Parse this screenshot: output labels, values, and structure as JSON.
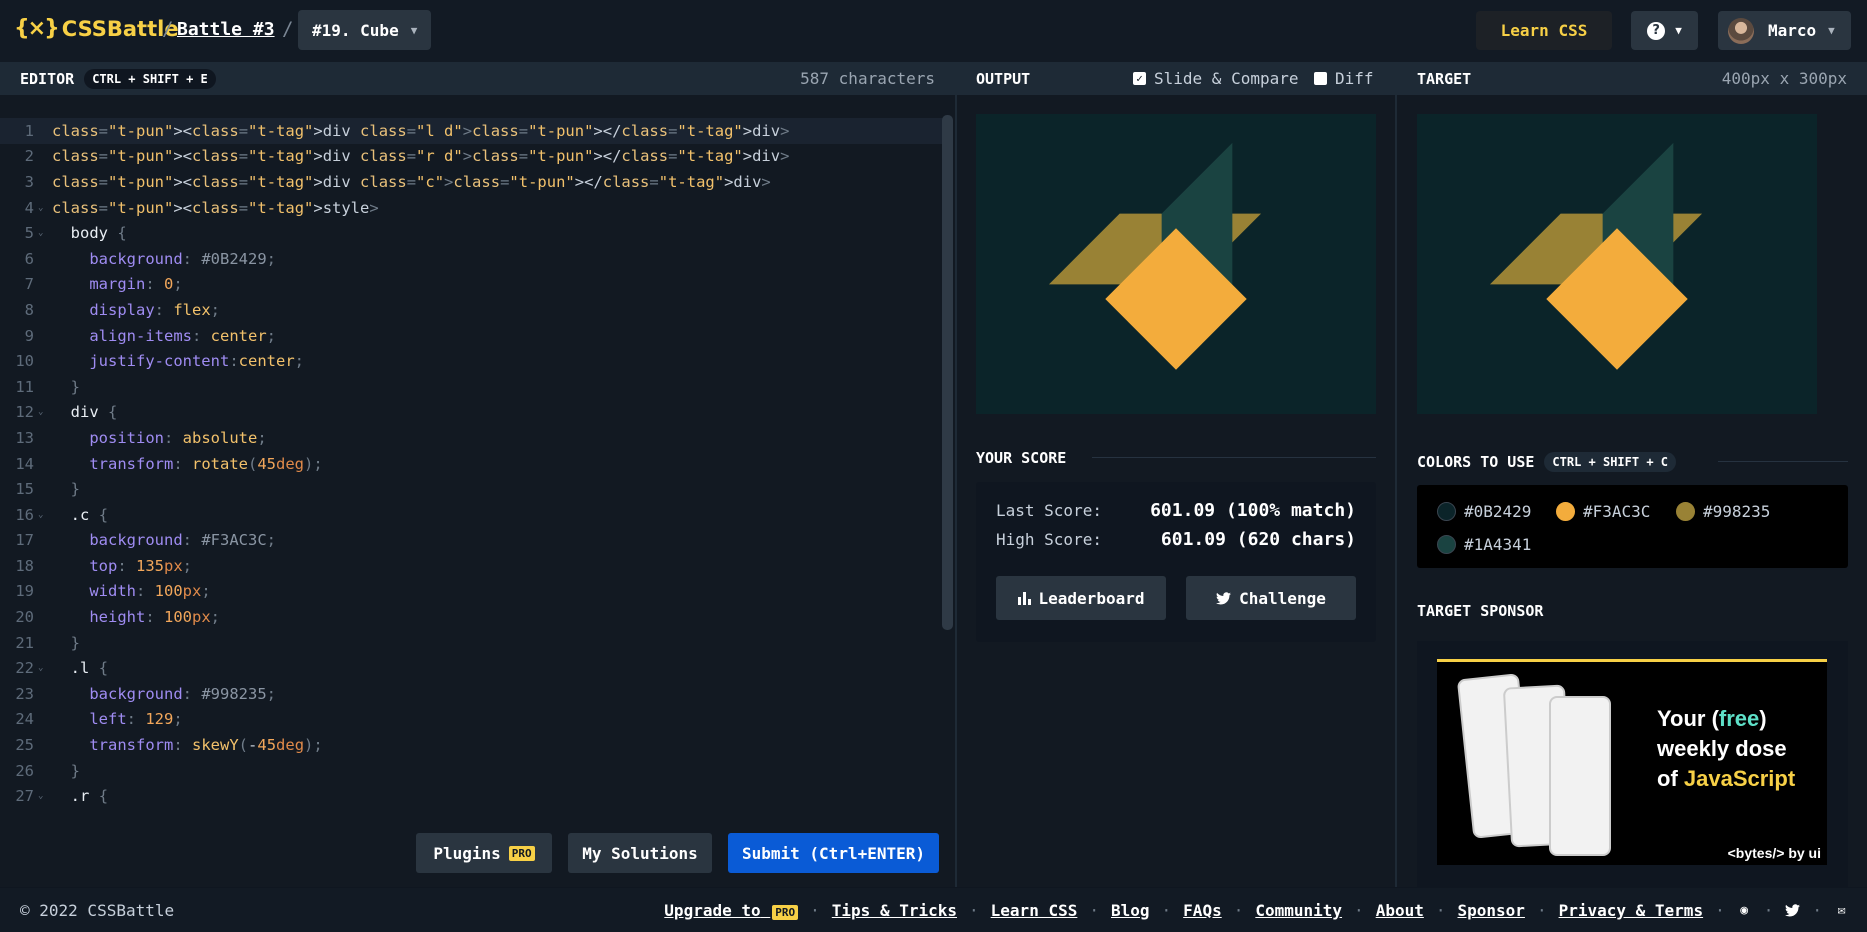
{
  "topbar": {
    "logo_mark": "{⨯}",
    "logo_text": "CSSBattle",
    "battle_link": "Battle #3",
    "level_select": "#19. Cube",
    "learn_css": "Learn CSS",
    "user_name": "Marco"
  },
  "editor": {
    "title": "EDITOR",
    "shortcut": "CTRL + SHIFT + E",
    "char_count": "587 characters",
    "lines": [
      "<div class=\"l d\"></div>",
      "<div class=\"r d\"></div>",
      "<div class=\"c\"></div>",
      "<style>",
      "  body {",
      "    background: #0B2429;",
      "    margin: 0;",
      "    display: flex;",
      "    align-items: center;",
      "    justify-content:center;",
      "  }",
      "  div {",
      "    position: absolute;",
      "    transform: rotate(45deg);",
      "  }",
      "  .c {",
      "    background: #F3AC3C;",
      "    top: 135px;",
      "    width: 100px;",
      "    height: 100px;",
      "  }",
      "  .l {",
      "    background: #998235;",
      "    left: 129;",
      "    transform: skewY(-45deg);",
      "  }",
      "  .r {"
    ],
    "plugins_label": "Plugins",
    "pro_badge": "PRO",
    "solutions_label": "My Solutions",
    "submit_label": "Submit (Ctrl+ENTER)"
  },
  "output": {
    "title": "OUTPUT",
    "slide_compare": "Slide & Compare",
    "slide_compare_checked": true,
    "diff": "Diff",
    "diff_checked": false
  },
  "score": {
    "title": "YOUR SCORE",
    "last_label": "Last Score:",
    "last_value": "601.09 (100% match)",
    "high_label": "High Score:",
    "high_value": "601.09 (620 chars)",
    "leaderboard": "Leaderboard",
    "challenge": "Challenge"
  },
  "target": {
    "title": "TARGET",
    "size": "400px x 300px",
    "colors_title": "COLORS TO USE",
    "colors_shortcut": "CTRL + SHIFT + C",
    "colors": [
      {
        "hex": "#0B2429",
        "label": "#0B2429"
      },
      {
        "hex": "#F3AC3C",
        "label": "#F3AC3C"
      },
      {
        "hex": "#998235",
        "label": "#998235"
      },
      {
        "hex": "#1A4341",
        "label": "#1A4341"
      }
    ],
    "sponsor_title": "TARGET SPONSOR",
    "ad_line1_a": "Your (",
    "ad_line1_free": "free",
    "ad_line1_b": ")",
    "ad_line2": "weekly dose",
    "ad_line3_a": "of ",
    "ad_line3_js": "JavaScript",
    "ad_brand": "<bytes/> by ui"
  },
  "footer": {
    "copyright": "© 2022 CSSBattle",
    "upgrade": "Upgrade to",
    "pro": "PRO",
    "links": [
      "Tips & Tricks",
      "Learn CSS",
      "Blog",
      "FAQs",
      "Community",
      "About",
      "Sponsor",
      "Privacy & Terms"
    ]
  },
  "icons": {
    "help": "help-icon",
    "chevron": "chevron-down-icon",
    "leaderboard": "bar-chart-icon",
    "challenge": "twitter-icon",
    "discord": "discord-icon",
    "twitter": "twitter-icon",
    "mail": "mail-icon"
  },
  "accent_colors": {
    "brand_yellow": "#F7D046",
    "submit_blue": "#0A5BD6"
  }
}
